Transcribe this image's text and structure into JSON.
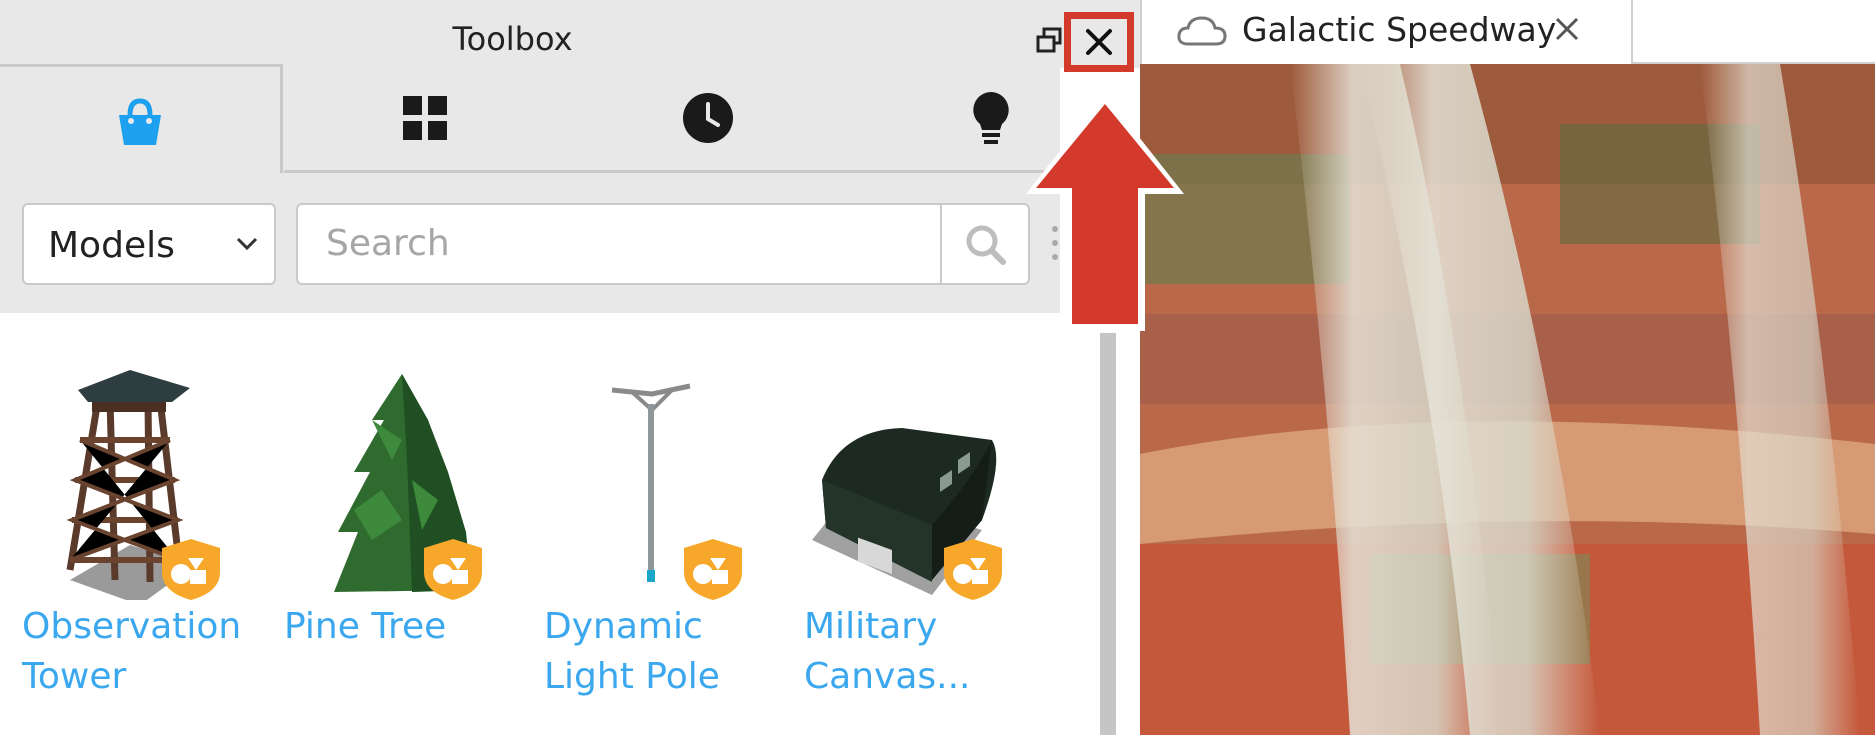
{
  "toolbox": {
    "title": "Toolbox",
    "tabs": [
      {
        "icon": "shopping-bag-icon",
        "active": true
      },
      {
        "icon": "grid-icon",
        "active": false
      },
      {
        "icon": "clock-icon",
        "active": false
      },
      {
        "icon": "lightbulb-icon",
        "active": false
      }
    ],
    "category": "Models",
    "search": {
      "placeholder": "Search",
      "value": ""
    },
    "items": [
      {
        "name": "Observation Tower",
        "line1": "Observation",
        "line2": "Tower"
      },
      {
        "name": "Pine Tree",
        "line1": "Pine Tree",
        "line2": ""
      },
      {
        "name": "Dynamic Light Pole",
        "line1": "Dynamic",
        "line2": "Light Pole"
      },
      {
        "name": "Military Canvas...",
        "line1": "Military",
        "line2": "Canvas..."
      }
    ],
    "colors": {
      "accent": "#1ea0f0",
      "link": "#3aa7ee",
      "highlight": "#d33a2c",
      "badge": "#f5a623"
    }
  },
  "document": {
    "tab_title": "Galactic Speedway"
  }
}
